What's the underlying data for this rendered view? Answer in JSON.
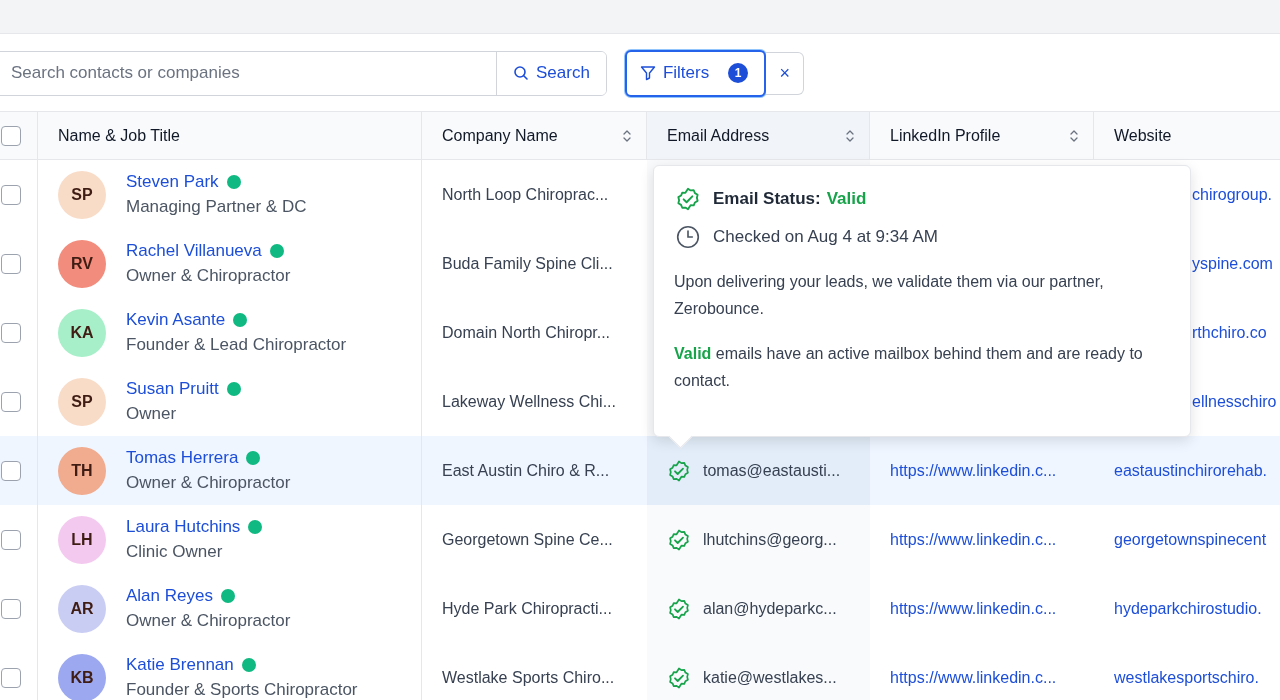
{
  "toolbar": {
    "search": {
      "placeholder": "Search contacts or companies"
    },
    "search_button": "Search",
    "filters_button": {
      "label": "Filters",
      "count": "1",
      "selected": true
    },
    "clear_button": "×"
  },
  "table": {
    "select_all_checked": false,
    "columns": [
      {
        "label": "Name & Job Title",
        "sortable": false
      },
      {
        "label": "Company Name",
        "sortable": true
      },
      {
        "label": "Email Address",
        "sortable": true
      },
      {
        "label": "LinkedIn Profile",
        "sortable": true
      },
      {
        "label": "Website",
        "sortable": false
      }
    ],
    "rows": [
      {
        "checked": false,
        "selected": false,
        "initials": "SP",
        "color": "#f8dcc8",
        "name": "Steven Park",
        "online": true,
        "title": "Managing Partner & DC",
        "company": "North Loop Chiroprac...",
        "website": "chirogroup."
      },
      {
        "checked": false,
        "selected": false,
        "initials": "RV",
        "color": "#f28c7c",
        "name": "Rachel Villanueva",
        "online": true,
        "title": "Owner & Chiropractor",
        "company": "Buda Family Spine Cli...",
        "website": "yspine.com"
      },
      {
        "checked": false,
        "selected": false,
        "initials": "KA",
        "color": "#a7efc9",
        "name": "Kevin Asante",
        "online": true,
        "title": "Founder & Lead Chiropractor",
        "company": "Domain North Chiropr...",
        "website": "rthchiro.co"
      },
      {
        "checked": false,
        "selected": false,
        "initials": "SP",
        "color": "#f8dcc8",
        "name": "Susan Pruitt",
        "online": true,
        "title": "Owner",
        "company": "Lakeway Wellness Chi...",
        "website": "ellnesschiro"
      },
      {
        "checked": false,
        "selected": true,
        "initials": "TH",
        "color": "#f1ab8e",
        "name": "Tomas Herrera",
        "online": true,
        "title": "Owner & Chiropractor",
        "company": "East Austin Chiro & R...",
        "email": "tomas@eastausti...",
        "email_valid": true,
        "linkedin": "https://www.linkedin.c...",
        "website": "eastaustinchirorehab."
      },
      {
        "checked": false,
        "selected": false,
        "initials": "LH",
        "color": "#f4c9f0",
        "name": "Laura Hutchins",
        "online": true,
        "title": "Clinic Owner",
        "company": "Georgetown Spine Ce...",
        "email": "lhutchins@georg...",
        "email_valid": true,
        "linkedin": "https://www.linkedin.c...",
        "website": "georgetownspinecent"
      },
      {
        "checked": false,
        "selected": false,
        "initials": "AR",
        "color": "#cacdf3",
        "name": "Alan Reyes",
        "online": true,
        "title": "Owner & Chiropractor",
        "company": "Hyde Park Chiropracti...",
        "email": "alan@hydeparkc...",
        "email_valid": true,
        "linkedin": "https://www.linkedin.c...",
        "website": "hydeparkchirostudio."
      },
      {
        "checked": false,
        "selected": false,
        "initials": "KB",
        "color": "#9ca8ef",
        "name": "Katie Brennan",
        "online": true,
        "title": "Founder & Sports Chiropractor",
        "company": "Westlake Sports Chiro...",
        "email": "katie@westlakes...",
        "email_valid": true,
        "linkedin": "https://www.linkedin.c...",
        "website": "westlakesportschiro."
      }
    ]
  },
  "popover": {
    "status_label": "Email Status:",
    "status": "Valid",
    "valid": true,
    "checked": "Checked on Aug 4 at 9:34 AM",
    "paragraphs": [
      "Upon delivering your leads, we validate them via our partner, Zerobounce.",
      "**Valid** emails have an active mailbox behind them and are ready to contact."
    ]
  }
}
